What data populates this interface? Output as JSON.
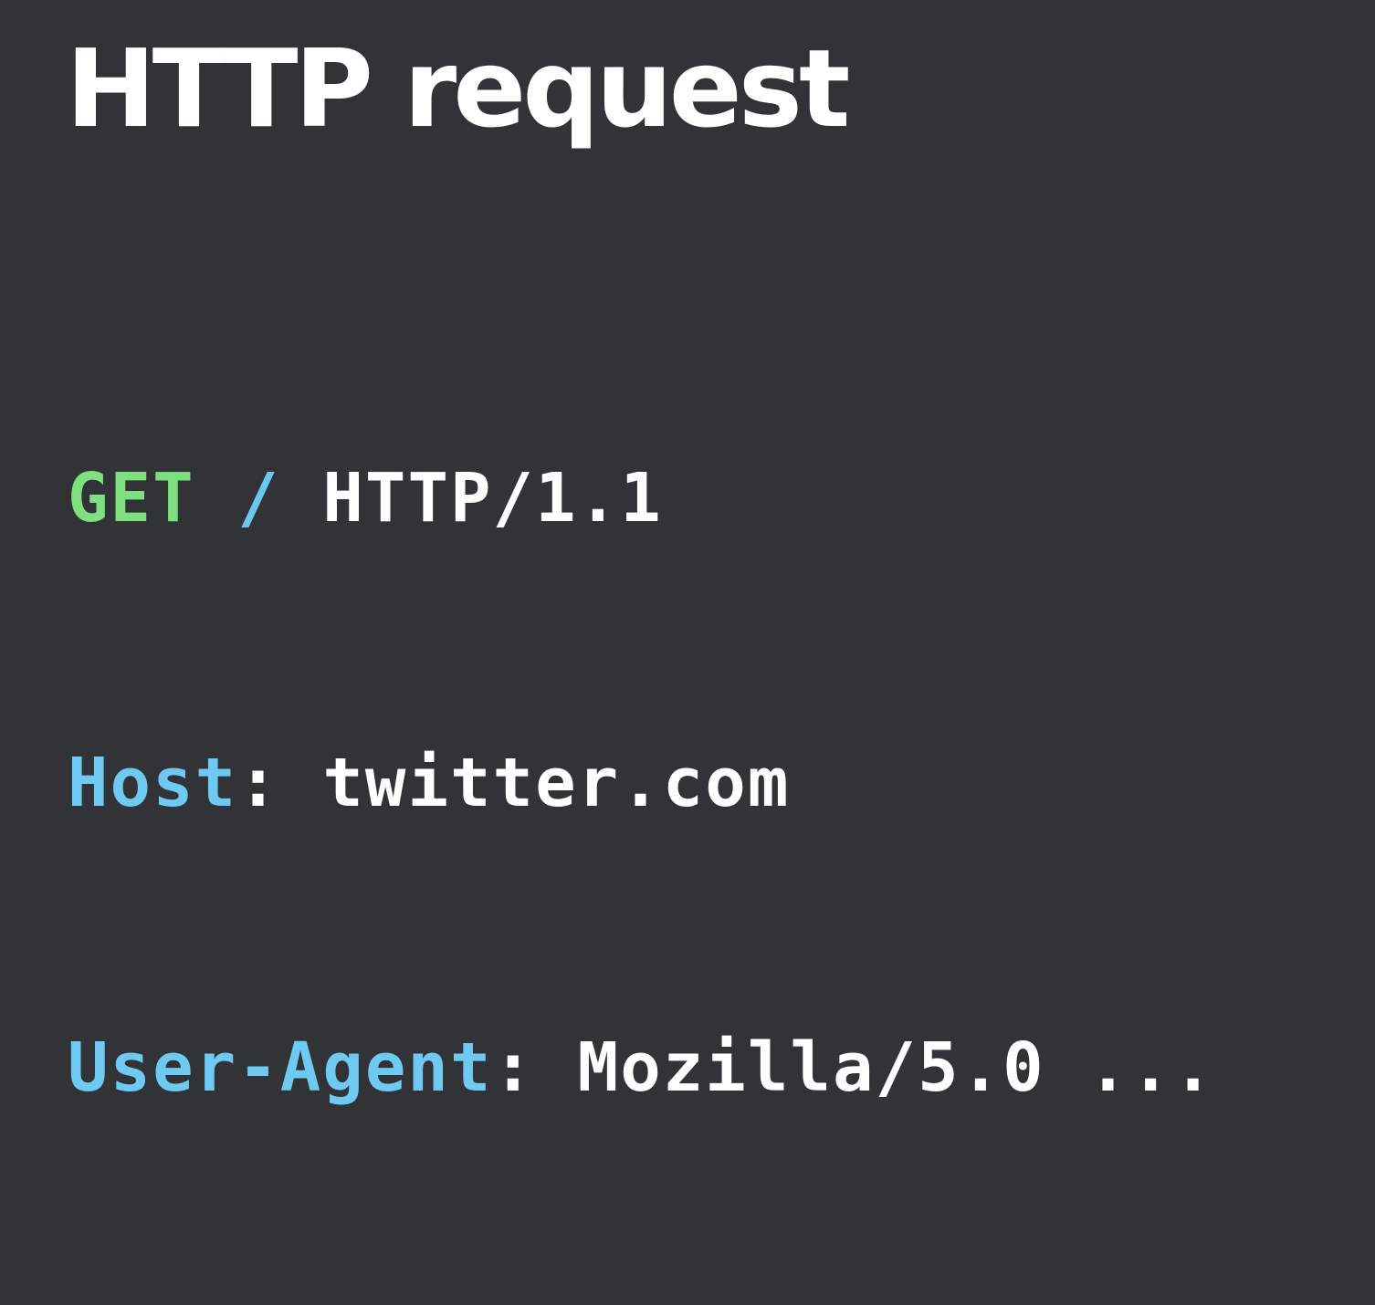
{
  "title": "HTTP request",
  "request": {
    "method": "GET",
    "path": "/",
    "version": "HTTP/1.1"
  },
  "headers": [
    {
      "name": "Host",
      "separator": ":",
      "value": "twitter.com"
    },
    {
      "name": "User-Agent",
      "separator": ":",
      "value": "Mozilla/5.0 ..."
    }
  ],
  "colors": {
    "background": "#323336",
    "title": "#ffffff",
    "method": "#7ee07f",
    "path": "#69c7f0",
    "header_name": "#6fcaf3",
    "text": "#ffffff"
  }
}
